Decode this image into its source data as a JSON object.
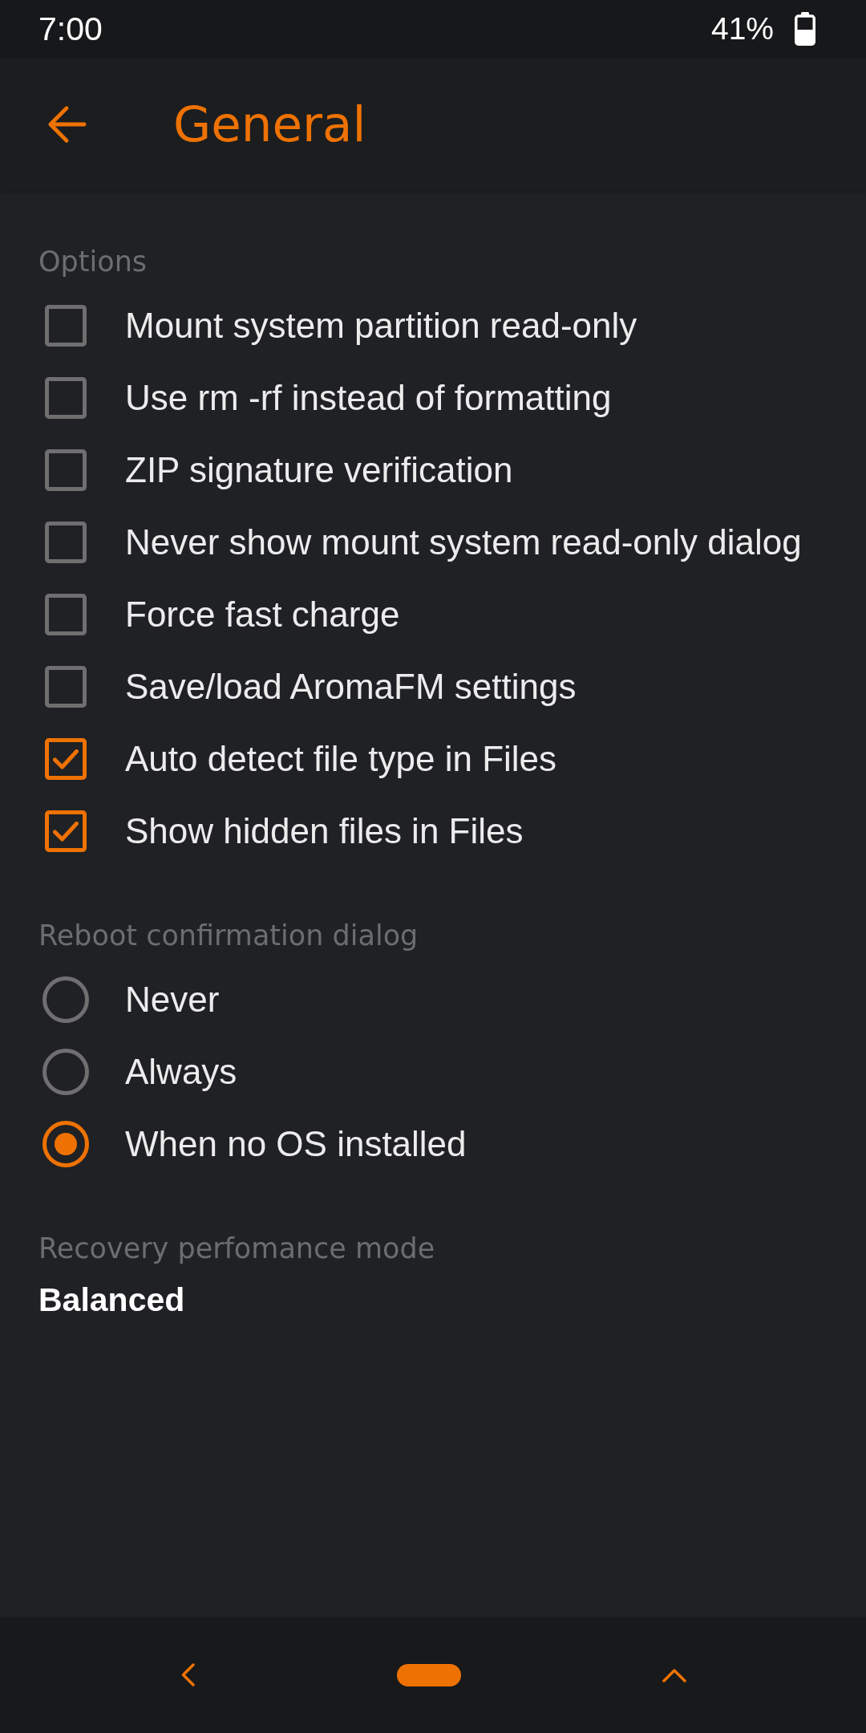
{
  "status_bar": {
    "time": "7:00",
    "battery": "41%"
  },
  "app_bar": {
    "title": "General"
  },
  "sections": [
    {
      "kind": "checkboxes",
      "header": "Options",
      "items": [
        {
          "label": "Mount system partition read-only",
          "checked": false
        },
        {
          "label": "Use rm -rf instead of formatting",
          "checked": false
        },
        {
          "label": "ZIP signature verification",
          "checked": false
        },
        {
          "label": "Never show mount system read-only dialog",
          "checked": false
        },
        {
          "label": "Force fast charge",
          "checked": false
        },
        {
          "label": "Save/load AromaFM settings",
          "checked": false
        },
        {
          "label": "Auto detect file type in Files",
          "checked": true
        },
        {
          "label": "Show hidden files in Files",
          "checked": true
        }
      ]
    },
    {
      "kind": "radios",
      "header": "Reboot confirmation dialog",
      "items": [
        {
          "label": "Never",
          "selected": false
        },
        {
          "label": "Always",
          "selected": false
        },
        {
          "label": "When no OS installed",
          "selected": true
        }
      ]
    },
    {
      "kind": "value",
      "header": "Recovery perfomance mode",
      "value": "Balanced"
    }
  ]
}
